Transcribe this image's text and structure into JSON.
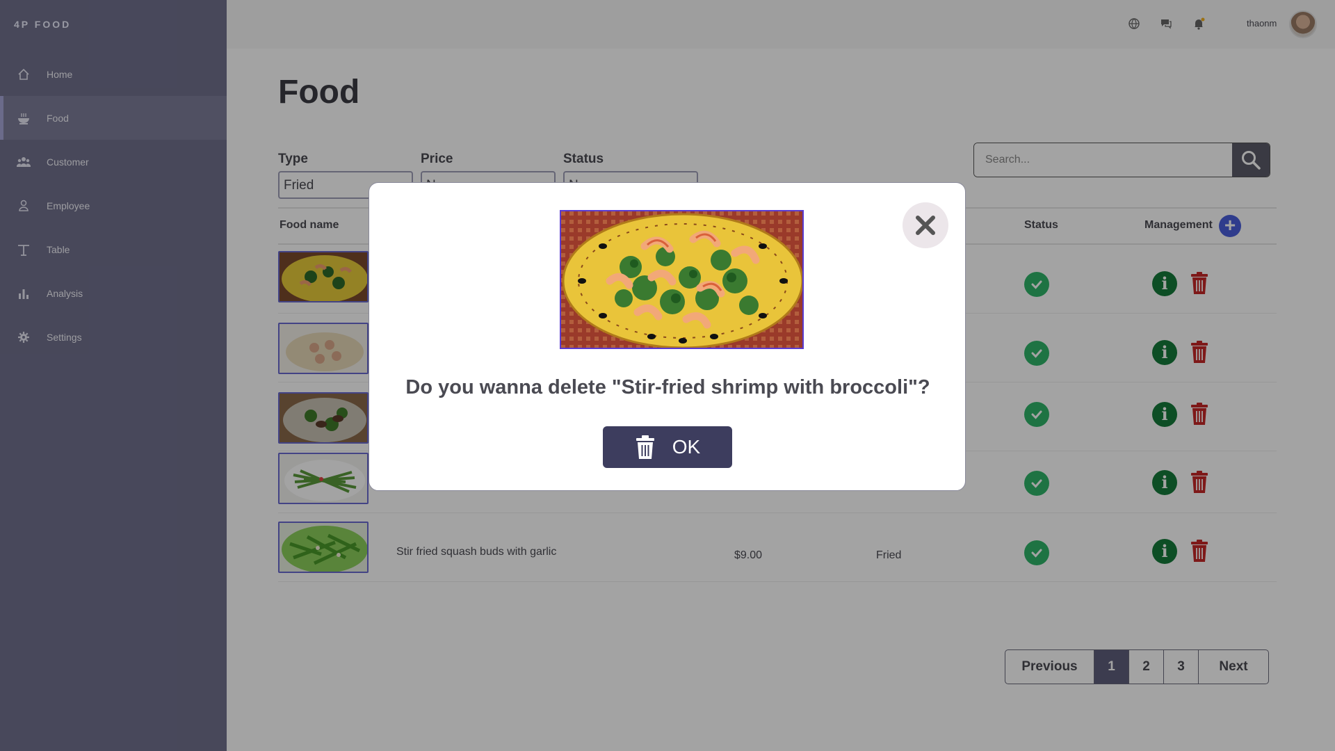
{
  "app": {
    "brand": "4P FOOD"
  },
  "sidebar": {
    "items": [
      {
        "label": "Home",
        "icon": "home-icon"
      },
      {
        "label": "Food",
        "icon": "food-bowl-icon",
        "active": true
      },
      {
        "label": "Customer",
        "icon": "users-icon"
      },
      {
        "label": "Employee",
        "icon": "user-icon"
      },
      {
        "label": "Table",
        "icon": "table-icon"
      },
      {
        "label": "Analysis",
        "icon": "bar-chart-icon"
      },
      {
        "label": "Settings",
        "icon": "gear-icon"
      }
    ]
  },
  "header": {
    "icons": [
      "globe-icon",
      "chat-icon",
      "bell-icon"
    ],
    "username": "thaonm"
  },
  "main": {
    "title": "Food",
    "filters": [
      {
        "label": "Type",
        "value": "Fried"
      },
      {
        "label": "Price",
        "value": "N"
      },
      {
        "label": "Status",
        "value": "N"
      }
    ],
    "search": {
      "placeholder": "Search..."
    },
    "table": {
      "headers": {
        "name": "Food name",
        "status": "Status",
        "management": "Management"
      },
      "rows": [
        {
          "name": "",
          "price": "",
          "type": "",
          "status": "available"
        },
        {
          "name": "",
          "price": "",
          "type": "",
          "status": "available"
        },
        {
          "name": "",
          "price": "",
          "type": "",
          "status": "available"
        },
        {
          "name": "",
          "price": "",
          "type": "",
          "status": "available"
        },
        {
          "name": "Stir fried squash buds with garlic",
          "price": "$9.00",
          "type": "Fried",
          "status": "available"
        }
      ]
    },
    "pagination": {
      "previous": "Previous",
      "pages": [
        "1",
        "2",
        "3"
      ],
      "current": "1",
      "next": "Next"
    }
  },
  "modal": {
    "message": "Do you wanna delete \"Stir-fried shrimp with broccoli\"?",
    "ok_label": "OK"
  },
  "colors": {
    "sidebar": "#71718e",
    "accent": "#3d3d5e",
    "status_ok": "#2fb56a",
    "info": "#157a3a",
    "danger": "#c62828",
    "add": "#4a5fdc"
  }
}
